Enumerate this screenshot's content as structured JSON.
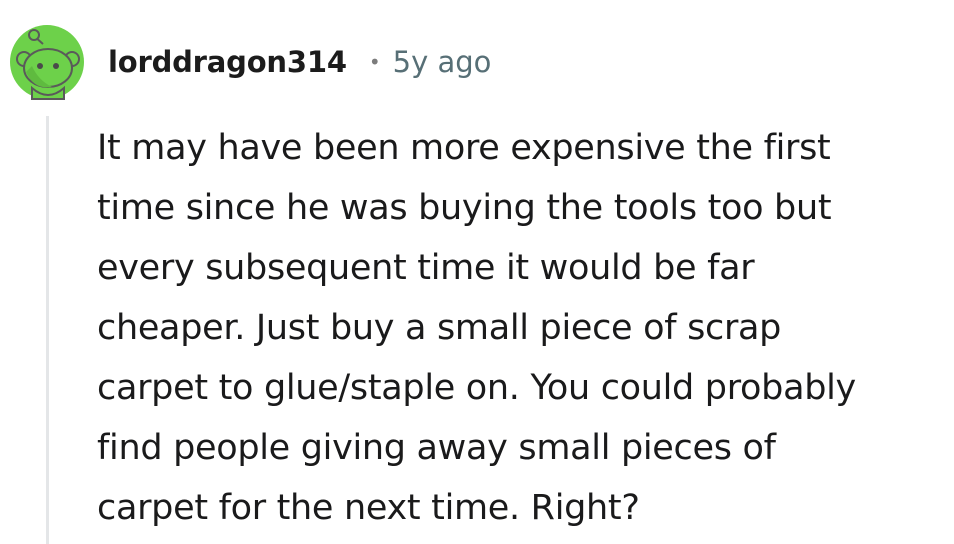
{
  "comment": {
    "author": "lorddragon314",
    "separator": "•",
    "timestamp": "5y ago",
    "avatar_icon": "snoo-avatar-icon",
    "avatar_color": "#6dd14a",
    "body": "It may have been more expensive the first\ntime since he was buying the tools too but\nevery subsequent time it would be far\ncheaper. Just buy a small piece of scrap\ncarpet to glue/staple on. You could probably\nfind people giving away small pieces of\ncarpet for the next time. Right?"
  }
}
